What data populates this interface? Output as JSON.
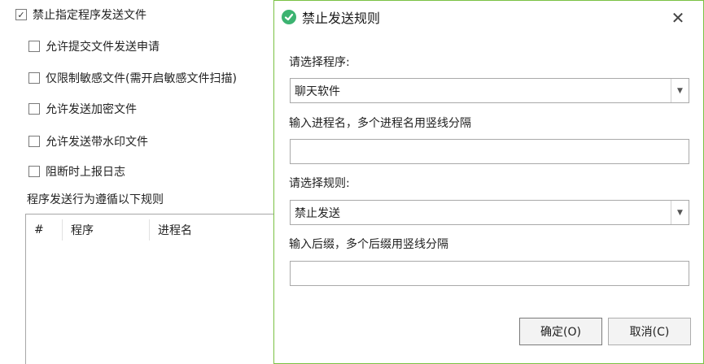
{
  "settings": {
    "main_option": {
      "label": "禁止指定程序发送文件",
      "checked": true,
      "mark": "✓"
    },
    "sub_options": [
      {
        "label": "允许提交文件发送申请",
        "checked": false
      },
      {
        "label": "仅限制敏感文件(需开启敏感文件扫描)",
        "checked": false
      },
      {
        "label": "允许发送加密文件",
        "checked": false
      },
      {
        "label": "允许发送带水印文件",
        "checked": false
      },
      {
        "label": "阻断时上报日志",
        "checked": false
      }
    ],
    "rules_caption": "程序发送行为遵循以下规则",
    "table_columns": [
      "#",
      "程序",
      "进程名"
    ]
  },
  "dialog": {
    "title": "禁止发送规则",
    "close_glyph": "✕",
    "program_label": "请选择程序:",
    "program_value": "聊天软件",
    "process_label": "输入进程名，多个进程名用竖线分隔",
    "process_value": "",
    "rule_label": "请选择规则:",
    "rule_value": "禁止发送",
    "suffix_label": "输入后缀，多个后缀用竖线分隔",
    "suffix_value": "",
    "dropdown_glyph": "▼",
    "ok_label": "确定(O)",
    "cancel_label": "取消(C)"
  },
  "colors": {
    "accent": "#7ac143",
    "icon_green": "#3cb371",
    "border": "#a9a9a9"
  }
}
